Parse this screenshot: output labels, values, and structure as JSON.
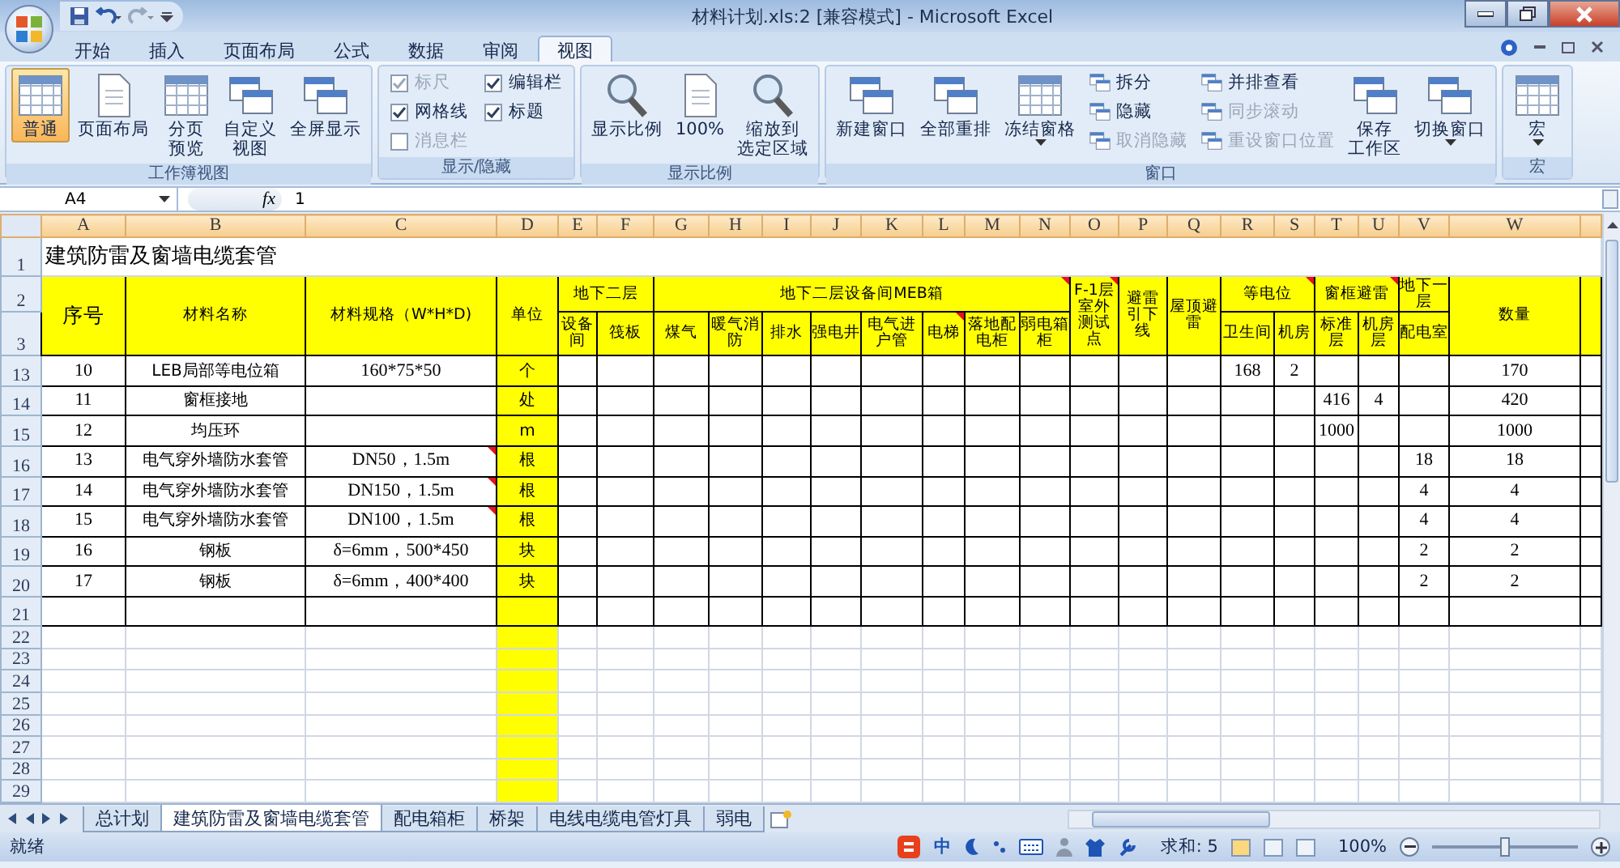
{
  "window": {
    "title": "材料计划.xls:2  [兼容模式] - Microsoft Excel"
  },
  "ribbon_tabs": [
    {
      "label": "开始",
      "selected": false
    },
    {
      "label": "插入",
      "selected": false
    },
    {
      "label": "页面布局",
      "selected": false
    },
    {
      "label": "公式",
      "selected": false
    },
    {
      "label": "数据",
      "selected": false
    },
    {
      "label": "审阅",
      "selected": false
    },
    {
      "label": "视图",
      "selected": true
    }
  ],
  "ribbon_groups": [
    {
      "label": "工作簿视图",
      "columns": [
        [
          {
            "kind": "large",
            "label_lines": [
              "普通"
            ],
            "selected": true
          }
        ],
        [
          {
            "kind": "large",
            "label_lines": [
              "页面布局"
            ],
            "selected": false
          }
        ],
        [
          {
            "kind": "large",
            "label_lines": [
              "分页",
              "预览"
            ],
            "selected": false
          }
        ],
        [
          {
            "kind": "large",
            "label_lines": [
              "自定义",
              "视图"
            ],
            "selected": false
          }
        ],
        [
          {
            "kind": "large",
            "label_lines": [
              "全屏显示"
            ],
            "selected": false
          }
        ]
      ]
    },
    {
      "label": "显示/隐藏",
      "columns": [
        [
          {
            "kind": "check",
            "label": "标尺",
            "checked": true,
            "disabled": true
          },
          {
            "kind": "check",
            "label": "网格线",
            "checked": true,
            "disabled": false
          },
          {
            "kind": "check",
            "label": "消息栏",
            "checked": false,
            "disabled": true
          }
        ],
        [
          {
            "kind": "check",
            "label": "编辑栏",
            "checked": true,
            "disabled": false
          },
          {
            "kind": "check",
            "label": "标题",
            "checked": true,
            "disabled": false
          }
        ]
      ]
    },
    {
      "label": "显示比例",
      "columns": [
        [
          {
            "kind": "large",
            "label_lines": [
              "显示比例"
            ]
          }
        ],
        [
          {
            "kind": "large",
            "label_lines": [
              "100%"
            ]
          }
        ],
        [
          {
            "kind": "large",
            "label_lines": [
              "缩放到",
              "选定区域"
            ]
          }
        ]
      ]
    },
    {
      "label": "窗口",
      "columns": [
        [
          {
            "kind": "large",
            "label_lines": [
              "新建窗口"
            ]
          }
        ],
        [
          {
            "kind": "large",
            "label_lines": [
              "全部重排"
            ]
          }
        ],
        [
          {
            "kind": "large",
            "label_lines": [
              "冻结窗格"
            ],
            "dropdown": true
          }
        ],
        [
          {
            "kind": "small",
            "label": "拆分",
            "disabled": false
          },
          {
            "kind": "small",
            "label": "隐藏",
            "disabled": false
          },
          {
            "kind": "small",
            "label": "取消隐藏",
            "disabled": true
          }
        ],
        [
          {
            "kind": "small",
            "label": "并排查看",
            "disabled": false
          },
          {
            "kind": "small",
            "label": "同步滚动",
            "disabled": true
          },
          {
            "kind": "small",
            "label": "重设窗口位置",
            "disabled": true
          }
        ],
        [
          {
            "kind": "large",
            "label_lines": [
              "保存",
              "工作区"
            ]
          }
        ],
        [
          {
            "kind": "large",
            "label_lines": [
              "切换窗口"
            ],
            "dropdown": true
          }
        ]
      ]
    },
    {
      "label": "宏",
      "columns": [
        [
          {
            "kind": "large",
            "label_lines": [
              "宏"
            ],
            "dropdown": true
          }
        ]
      ]
    }
  ],
  "formula_bar": {
    "name_box": "A4",
    "function_label": "fx",
    "value": "1"
  },
  "sheet": {
    "column_headers": [
      "A",
      "B",
      "C",
      "D",
      "E",
      "F",
      "G",
      "H",
      "I",
      "J",
      "K",
      "L",
      "M",
      "N",
      "O",
      "P",
      "Q",
      "R",
      "S",
      "T",
      "U",
      "V",
      "W"
    ],
    "title_row": {
      "row": "1",
      "text": "建筑防雷及窗墙电缆套管"
    },
    "header_row_numbers": [
      "2",
      "3"
    ],
    "headers": [
      {
        "text": "序号",
        "comment": false
      },
      {
        "text": "材料名称",
        "comment": false
      },
      {
        "text": "材料规格（W*H*D)",
        "comment": false
      },
      {
        "text": "单位",
        "comment": false
      },
      {
        "text": "地下二层",
        "comment": false,
        "children": [
          {
            "text": "设备间",
            "comment": false
          },
          {
            "text": "筏板",
            "comment": false
          }
        ]
      },
      {
        "text": "地下二层设备间MEB箱",
        "comment": true,
        "children": [
          {
            "text": "煤气",
            "comment": false
          },
          {
            "text": "暖气消防",
            "comment": false
          },
          {
            "text": "排水",
            "comment": false
          },
          {
            "text": "强电井",
            "comment": false
          },
          {
            "text": "电气进户管",
            "comment": false
          },
          {
            "text": "电梯",
            "comment": true
          },
          {
            "text": "落地配电柜",
            "comment": false
          },
          {
            "text": "弱电箱柜",
            "comment": false
          }
        ]
      },
      {
        "text": "F-1层室外测试点",
        "comment": true
      },
      {
        "text": "避雷引下线",
        "comment": false
      },
      {
        "text": "屋顶避雷",
        "comment": false
      },
      {
        "text": "等电位",
        "comment": true,
        "children": [
          {
            "text": "卫生间",
            "comment": false
          },
          {
            "text": "机房",
            "comment": false
          }
        ]
      },
      {
        "text": "窗框避雷",
        "comment": true,
        "children": [
          {
            "text": "标准层",
            "comment": false
          },
          {
            "text": "机房层",
            "comment": false
          }
        ]
      },
      {
        "text": "地下一层",
        "comment": false,
        "children": [
          {
            "text": "配电室",
            "comment": false
          }
        ]
      },
      {
        "text": "数量",
        "comment": false
      }
    ],
    "rows": [
      {
        "row": "13",
        "cells": {
          "A": "10",
          "B": "LEB局部等电位箱",
          "C": "160*75*50",
          "D": "个",
          "R": "168",
          "S": "2",
          "W": "170"
        },
        "spec_comment": false
      },
      {
        "row": "14",
        "cells": {
          "A": "11",
          "B": "窗框接地",
          "D": "处",
          "T": "416",
          "U": "4",
          "W": "420"
        },
        "spec_comment": false
      },
      {
        "row": "15",
        "cells": {
          "A": "12",
          "B": "均压环",
          "D": "m",
          "T": "1000",
          "W": "1000"
        },
        "spec_comment": false
      },
      {
        "row": "16",
        "cells": {
          "A": "13",
          "B": "电气穿外墙防水套管",
          "C": "DN50，1.5m",
          "D": "根",
          "V": "18",
          "W": "18"
        },
        "spec_comment": true
      },
      {
        "row": "17",
        "cells": {
          "A": "14",
          "B": "电气穿外墙防水套管",
          "C": "DN150，1.5m",
          "D": "根",
          "V": "4",
          "W": "4"
        },
        "spec_comment": true
      },
      {
        "row": "18",
        "cells": {
          "A": "15",
          "B": "电气穿外墙防水套管",
          "C": "DN100，1.5m",
          "D": "根",
          "V": "4",
          "W": "4"
        },
        "spec_comment": true
      },
      {
        "row": "19",
        "cells": {
          "A": "16",
          "B": "钢板",
          "C": "δ=6mm，500*450",
          "D": "块",
          "V": "2",
          "W": "2"
        },
        "spec_comment": false
      },
      {
        "row": "20",
        "cells": {
          "A": "17",
          "B": "钢板",
          "C": "δ=6mm，400*400",
          "D": "块",
          "V": "2",
          "W": "2"
        },
        "spec_comment": false
      },
      {
        "row": "21",
        "cells": {},
        "spec_comment": false
      }
    ],
    "empty_rows": [
      "22",
      "23",
      "24",
      "25",
      "26",
      "27",
      "28",
      "29"
    ]
  },
  "sheet_tabs": [
    {
      "label": "总计划",
      "selected": false
    },
    {
      "label": "建筑防雷及窗墙电缆套管",
      "selected": true
    },
    {
      "label": "配电箱柜",
      "selected": false
    },
    {
      "label": "桥架",
      "selected": false
    },
    {
      "label": "电线电缆电管灯具",
      "selected": false
    },
    {
      "label": "弱电",
      "selected": false
    }
  ],
  "status_bar": {
    "status": "就绪",
    "ime_label": "中",
    "sum": "求和: 5",
    "zoom": "100%",
    "zoom_slider": {
      "level": 0.5
    }
  }
}
